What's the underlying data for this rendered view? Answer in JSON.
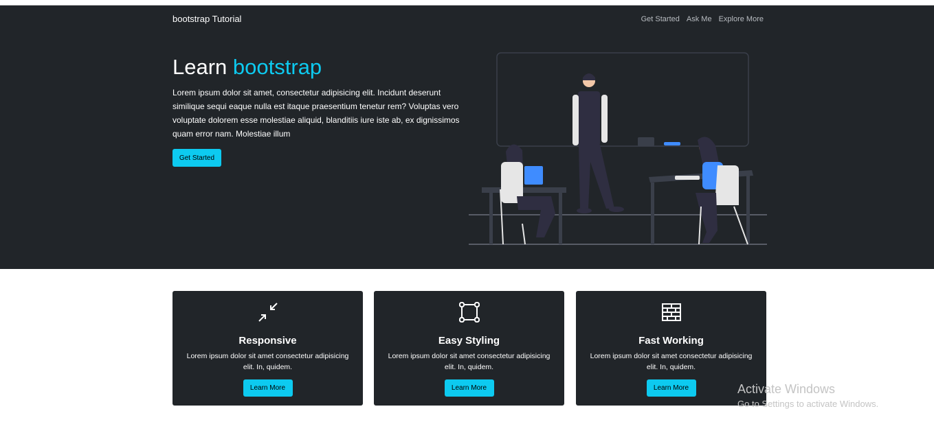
{
  "navbar": {
    "brand": "bootstrap Tutorial",
    "links": [
      "Get Started",
      "Ask Me",
      "Explore More"
    ]
  },
  "hero": {
    "title_plain": "Learn",
    "title_accent": "bootstrap",
    "text": "Lorem ipsum dolor sit amet, consectetur adipisicing elit. Incidunt deserunt similique sequi eaque nulla est itaque praesentium tenetur rem? Voluptas vero voluptate dolorem esse molestiae aliquid, blanditiis iure iste ab, ex dignissimos quam error nam. Molestiae illum",
    "button": "Get Started"
  },
  "cards": [
    {
      "icon": "arrows-collapse-icon",
      "title": "Responsive",
      "text": "Lorem ipsum dolor sit amet consectetur adipisicing elit. In, quidem.",
      "button": "Learn More"
    },
    {
      "icon": "bounding-box-icon",
      "title": "Easy Styling",
      "text": "Lorem ipsum dolor sit amet consectetur adipisicing elit. In, quidem.",
      "button": "Learn More"
    },
    {
      "icon": "bricks-icon",
      "title": "Fast Working",
      "text": "Lorem ipsum dolor sit amet consectetur adipisicing elit. In, quidem.",
      "button": "Learn More"
    }
  ],
  "watermark": {
    "title": "Activate Windows",
    "subtitle": "Go to Settings to activate Windows."
  },
  "colors": {
    "dark": "#212529",
    "accent": "#0dcaf0",
    "illustration_blue": "#3f8cff"
  }
}
